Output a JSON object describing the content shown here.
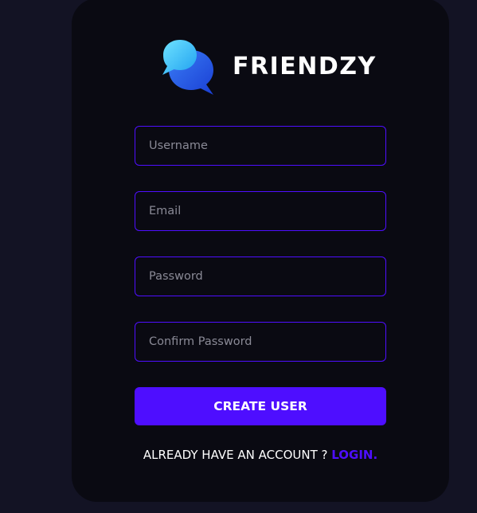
{
  "brand": {
    "name": "FRIENDZY",
    "logo_icon": "chat-bubbles-icon"
  },
  "form": {
    "username_placeholder": "Username",
    "email_placeholder": "Email",
    "password_placeholder": "Password",
    "confirm_password_placeholder": "Confirm Password",
    "submit_label": "CREATE USER"
  },
  "footer": {
    "prompt": "ALREADY HAVE AN ACCOUNT ? ",
    "link_label": "LOGIN."
  },
  "colors": {
    "background": "#131324",
    "card": "#0a0a12",
    "accent": "#4e0eff",
    "text": "#ffffff",
    "placeholder": "#8a8a96"
  }
}
